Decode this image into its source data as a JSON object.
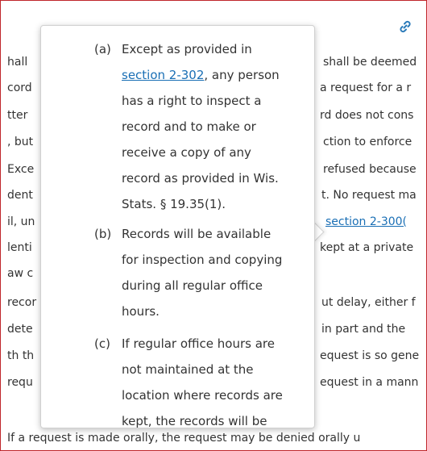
{
  "background": {
    "lines": [
      {
        "left": "hall",
        "right": "shall be deemed"
      },
      {
        "left": "cord",
        "right": "a request for a r"
      },
      {
        "left": "tter",
        "right": "rd does not cons"
      },
      {
        "left": ", but",
        "right": "ction to enforce"
      },
      {
        "left": "Exce",
        "right": "refused because"
      },
      {
        "left": "dent",
        "right": "t. No request ma"
      },
      {
        "left": "il, un",
        "right_prefix": "",
        "right_link": "section 2-300(",
        "right": ""
      },
      {
        "left": "lenti",
        "right": "kept at a private"
      },
      {
        "left": "aw c",
        "right": ""
      },
      {
        "left": "recor",
        "right": "ut delay, either f"
      },
      {
        "left": "dete",
        "right": "in part and the"
      },
      {
        "left": "th th",
        "right": "equest is so gene"
      },
      {
        "left": "requ",
        "right": "equest in a mann"
      }
    ],
    "bottom_line": "If a request is made orally, the request may be denied orally u"
  },
  "tooltip": {
    "items": [
      {
        "label": "(a)",
        "lines": [
          "Except as provided in",
          "",
          "has a right to inspect a",
          "record and to make or",
          "receive a copy of any",
          "record as provided in Wis.",
          "Stats. § 19.35(1)."
        ],
        "link_text": "section 2-302",
        "link_suffix": ", any person"
      },
      {
        "label": "(b)",
        "lines": [
          "Records will be available",
          "for inspection and copying",
          "during all regular office",
          "hours."
        ]
      },
      {
        "label": "(c)",
        "lines": [
          "If regular office hours are",
          "not maintained at the",
          "location where records are",
          "kept, the records will be"
        ]
      }
    ]
  },
  "icons": {
    "permalink": "link-icon"
  }
}
